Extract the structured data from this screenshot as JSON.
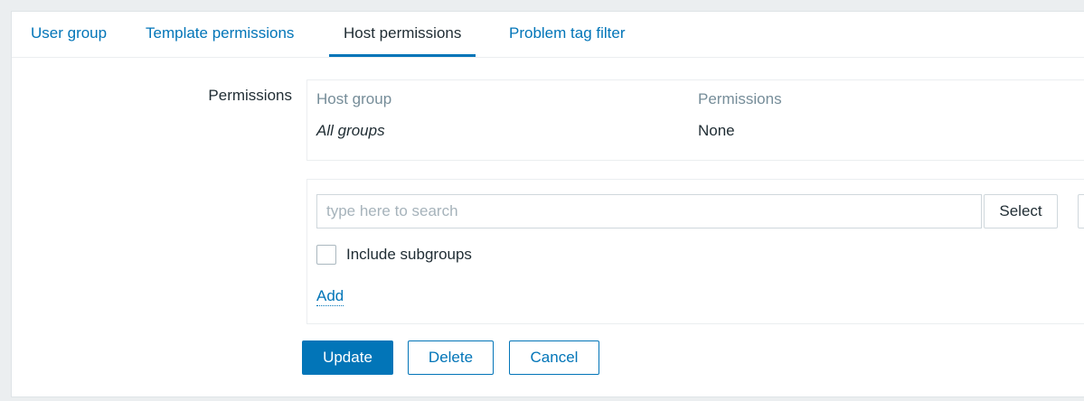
{
  "tabs": [
    {
      "label": "User group",
      "active": false
    },
    {
      "label": "Template permissions",
      "active": false
    },
    {
      "label": "Host permissions",
      "active": true
    },
    {
      "label": "Problem tag filter",
      "active": false
    }
  ],
  "form": {
    "permissions_label": "Permissions"
  },
  "permissions_table": {
    "columns": [
      "Host group",
      "Permissions"
    ],
    "rows": [
      {
        "host_group": "All groups",
        "permission": "None"
      }
    ]
  },
  "add_section": {
    "search_value": "",
    "search_placeholder": "type here to search",
    "select_label": "Select",
    "include_subgroups_label": "Include subgroups",
    "include_subgroups_checked": false,
    "add_label": "Add"
  },
  "actions": {
    "update_label": "Update",
    "delete_label": "Delete",
    "cancel_label": "Cancel"
  },
  "colors": {
    "accent": "#0275b8",
    "text": "#1f2c33",
    "muted": "#768d99",
    "background": "#ebeef0"
  }
}
